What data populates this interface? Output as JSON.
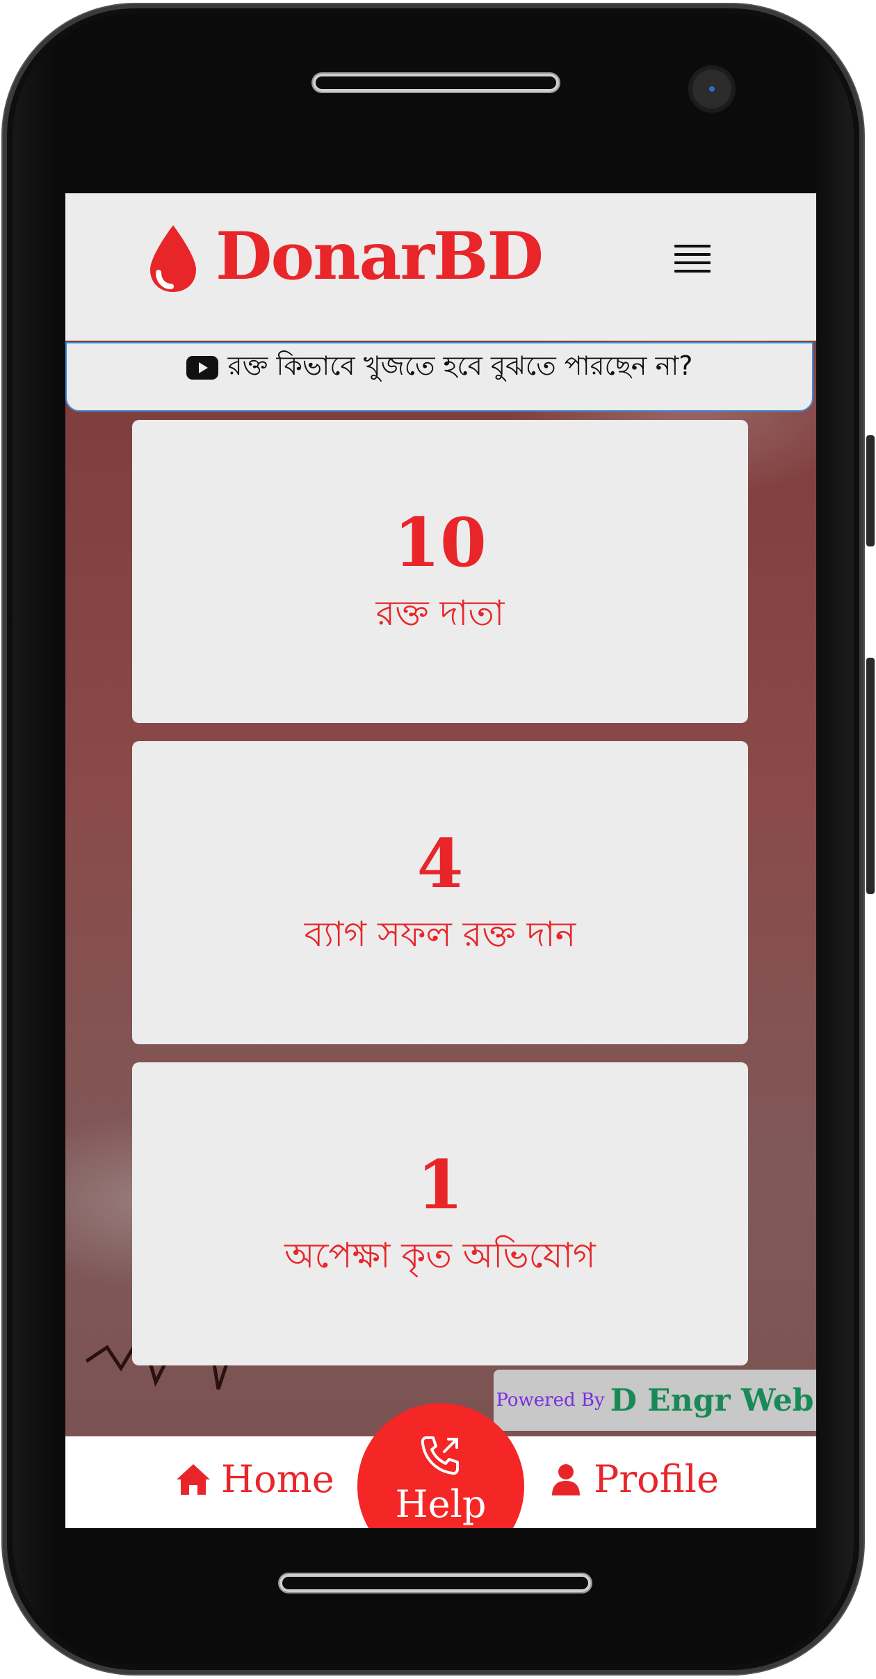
{
  "header": {
    "brand": "DonarBD",
    "brand_icon": "blood-drop-icon",
    "menu_icon": "hamburger-menu-icon"
  },
  "banner": {
    "icon": "youtube-icon",
    "text": "রক্ত কিভাবে খুজতে হবে বুঝতে পারছেন না?"
  },
  "stats": [
    {
      "value": "10",
      "label": "রক্ত দাতা"
    },
    {
      "value": "4",
      "label": "ব্যাগ সফল রক্ত দান"
    },
    {
      "value": "1",
      "label": "অপেক্ষা কৃত অভিযোগ"
    }
  ],
  "powered": {
    "prefix": "Powered By",
    "name": "D Engr Web"
  },
  "bottom_nav": {
    "home": "Home",
    "help": "Help",
    "profile": "Profile"
  },
  "colors": {
    "brand_red": "#e8262a",
    "help_red": "#f42626",
    "powered_purple": "#7a2fe0",
    "powered_green": "#198a55",
    "banner_border": "#3f8ad6"
  }
}
